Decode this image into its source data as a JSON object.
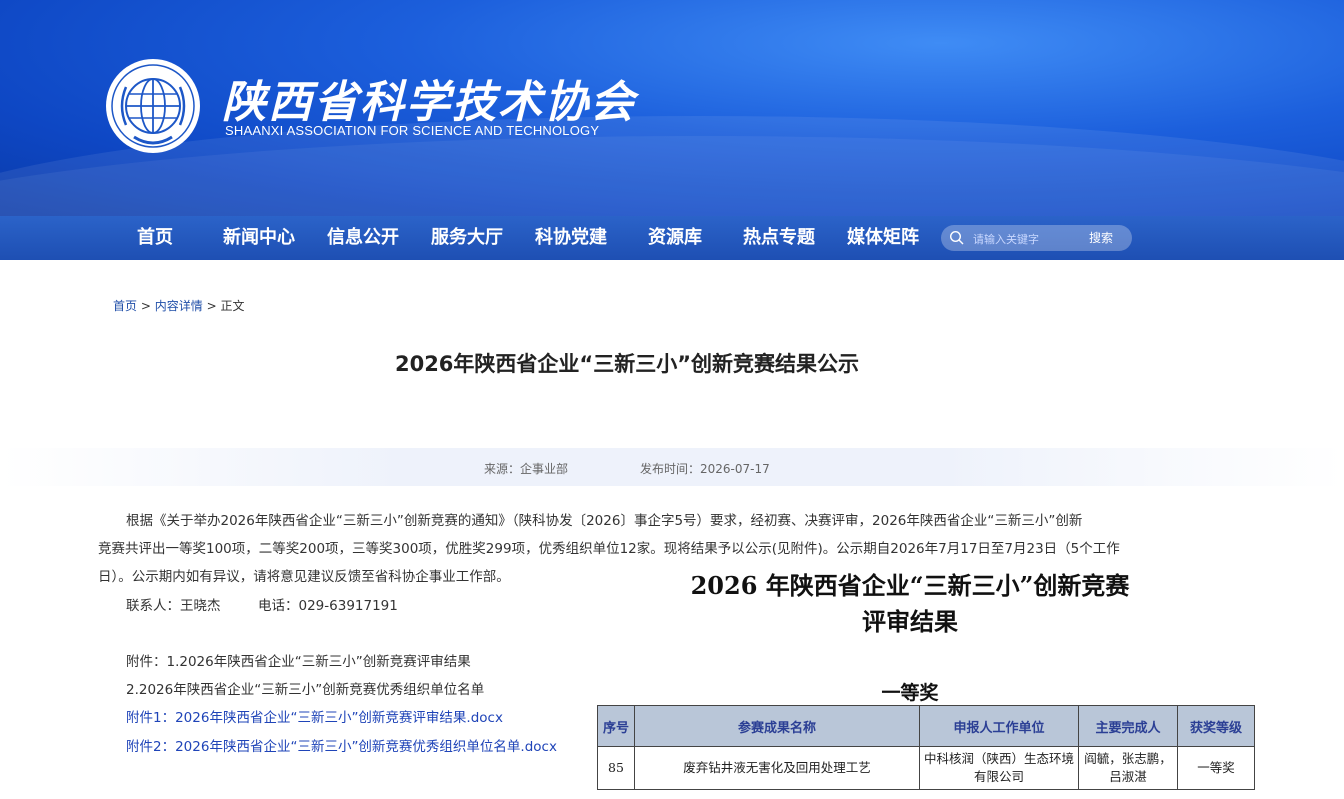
{
  "header": {
    "org_name_cn": "陕西省科学技术协会",
    "org_name_en": "SHAANXI ASSOCIATION FOR SCIENCE AND TECHNOLOGY",
    "emblem_text": "CHINA ASSOCIATION FOR SCIENCE AND TECHNOLOGY"
  },
  "nav": {
    "items": [
      "首页",
      "新闻中心",
      "信息公开",
      "服务大厅",
      "科协党建",
      "资源库",
      "热点专题",
      "媒体矩阵"
    ],
    "search_placeholder": "请输入关键字",
    "search_button": "搜索"
  },
  "breadcrumb": {
    "home": "首页",
    "sep1": ">",
    "detail": "内容详情",
    "sep2": ">",
    "current": "正文"
  },
  "article": {
    "title": "2026年陕西省企业“三新三小”创新竞赛结果公示",
    "source": "来源：企事业部",
    "published": "发布时间：2026-07-17",
    "para_line1": "根据《关于举办2026年陕西省企业“三新三小”创新竞赛的通知》（陕科协发〔2026〕事企字5号）要求，经初赛、决赛评审，2026年陕西省企业“三新三小”创新",
    "para_line2": "竞赛共评出一等奖100项，二等奖200项，三等奖300项，优胜奖299项，优秀组织单位12家。现将结果予以公示(见附件)。公示期自2026年7月17日至7月23日（5个工作",
    "para_line3": "日）。公示期内如有异议，请将意见建议反馈至省科协企事业工作部。",
    "contact": "联系人：王晓杰",
    "phone": "电话：029-63917191",
    "attach_line1": "附件：1.2026年陕西省企业“三新三小”创新竞赛评审结果",
    "attach_line2": "2.2026年陕西省企业“三新三小”创新竞赛优秀组织单位名单",
    "link1": "附件1：2026年陕西省企业“三新三小”创新竞赛评审结果.docx",
    "link2": "附件2：2026年陕西省企业“三新三小”创新竞赛优秀组织单位名单.docx"
  },
  "doc_preview": {
    "heading_line1": "2026 年陕西省企业“三新三小”创新竞赛",
    "heading_line2": "评审结果",
    "section": "一等奖",
    "columns": [
      "序号",
      "参赛成果名称",
      "申报人工作单位",
      "主要完成人",
      "获奖等级"
    ],
    "rows": [
      [
        "85",
        "废弃钻井液无害化及回用处理工艺",
        "中科核润（陕西）生态环境有限公司",
        "阎毓，张志鹏，吕淑湛",
        "一等奖"
      ]
    ]
  },
  "colors": {
    "banner": "#1c5fdc",
    "nav": "#2257bd",
    "link": "#1f44b8",
    "table_header": "#b9c6d8"
  }
}
